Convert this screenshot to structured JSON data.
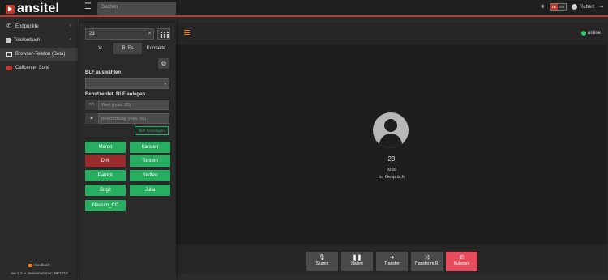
{
  "brand": {
    "name": "ansitel"
  },
  "topbar": {
    "search_placeholder": "Suchen",
    "lang_de": "DE",
    "lang_en": "EN",
    "user_name": "Robert"
  },
  "sidebar": {
    "items": [
      {
        "label": "Endpunkte"
      },
      {
        "label": "Telefonbuch"
      },
      {
        "label": "Browser-Telefon (Beta)"
      },
      {
        "label": "Callcenter Suite"
      }
    ],
    "handbook": "Handbuch",
    "version": "awi 5.2",
    "serial": "Seriennummer: 9901313"
  },
  "panel": {
    "dial_value": "23",
    "tabs": [
      "",
      "BLFs",
      "Kontakte"
    ],
    "blf_select_label": "BLF auswählen",
    "custom_blf_label": "Benutzerdef. BLF anlegen",
    "value_placeholder": "Wert (max. 30)",
    "caption_placeholder": "Beschriftung (max. 50)",
    "add_button": "BLF hinzufügen",
    "blfs": [
      {
        "name": "Marco",
        "state": "green"
      },
      {
        "name": "Karsten",
        "state": "green"
      },
      {
        "name": "Dirk",
        "state": "red"
      },
      {
        "name": "Torsten",
        "state": "green"
      },
      {
        "name": "Patrick",
        "state": "green"
      },
      {
        "name": "Steffen",
        "state": "green"
      },
      {
        "name": "Birgit",
        "state": "green"
      },
      {
        "name": "Julia",
        "state": "green"
      },
      {
        "name": "Nassim_CC",
        "state": "green"
      }
    ]
  },
  "call": {
    "status": "online",
    "number": "23",
    "timer": "00:00",
    "state": "Im Gespräch",
    "controls": [
      {
        "label": "Stumm",
        "icon": "microphone-icon"
      },
      {
        "label": "Halten",
        "icon": "pause-icon"
      },
      {
        "label": "Transfer",
        "icon": "arrow-right-icon"
      },
      {
        "label": "Transfer m.R.",
        "icon": "shuffle-icon"
      },
      {
        "label": "Auflegen",
        "icon": "hangup-icon"
      }
    ]
  },
  "colors": {
    "accent": "#c0392b",
    "ok": "#27ae60",
    "busy": "#9b2c2c",
    "hangup": "#e74c5c"
  }
}
